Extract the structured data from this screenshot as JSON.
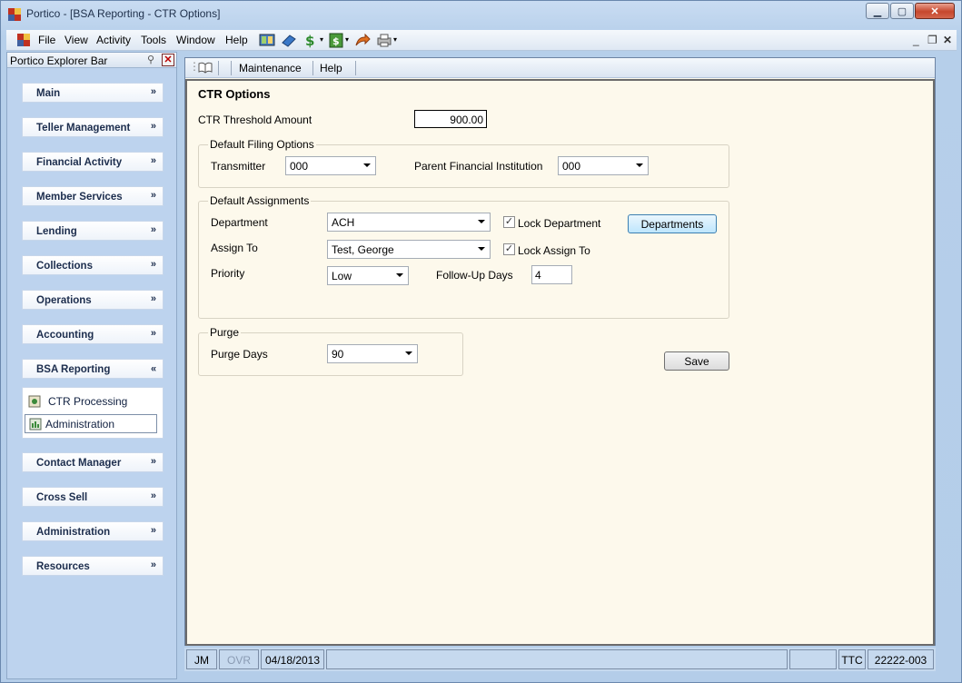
{
  "window": {
    "title": "Portico - [BSA Reporting - CTR Options]"
  },
  "menu": {
    "items": [
      "File",
      "View",
      "Activity",
      "Tools",
      "Window",
      "Help"
    ]
  },
  "explorer": {
    "title": "Portico Explorer Bar",
    "groups": [
      "Main",
      "Teller Management",
      "Financial Activity",
      "Member Services",
      "Lending",
      "Collections",
      "Operations",
      "Accounting",
      "BSA Reporting",
      "Contact Manager",
      "Cross Sell",
      "Administration",
      "Resources"
    ],
    "bsa_items": [
      "CTR Processing",
      "Administration"
    ]
  },
  "child_menu": {
    "items": [
      "Maintenance",
      "Help"
    ]
  },
  "form": {
    "heading": "CTR Options",
    "threshold_label": "CTR Threshold Amount",
    "threshold_value": "900.00",
    "filing": {
      "title": "Default Filing Options",
      "transmitter_label": "Transmitter",
      "transmitter_value": "000",
      "parent_label": "Parent Financial Institution",
      "parent_value": "000"
    },
    "assign": {
      "title": "Default Assignments",
      "department_label": "Department",
      "department_value": "ACH",
      "lock_department_label": "Lock Department",
      "lock_department_checked": true,
      "departments_button": "Departments",
      "assign_to_label": "Assign To",
      "assign_to_value": "Test, George",
      "lock_assign_label": "Lock Assign To",
      "lock_assign_checked": true,
      "priority_label": "Priority",
      "priority_value": "Low",
      "followup_label": "Follow-Up Days",
      "followup_value": "4"
    },
    "purge": {
      "title": "Purge",
      "purge_days_label": "Purge Days",
      "purge_days_value": "90"
    },
    "save_button": "Save"
  },
  "status": {
    "user": "JM",
    "ovr": "OVR",
    "date": "04/18/2013",
    "ttc": "TTC",
    "account": "22222-003"
  }
}
